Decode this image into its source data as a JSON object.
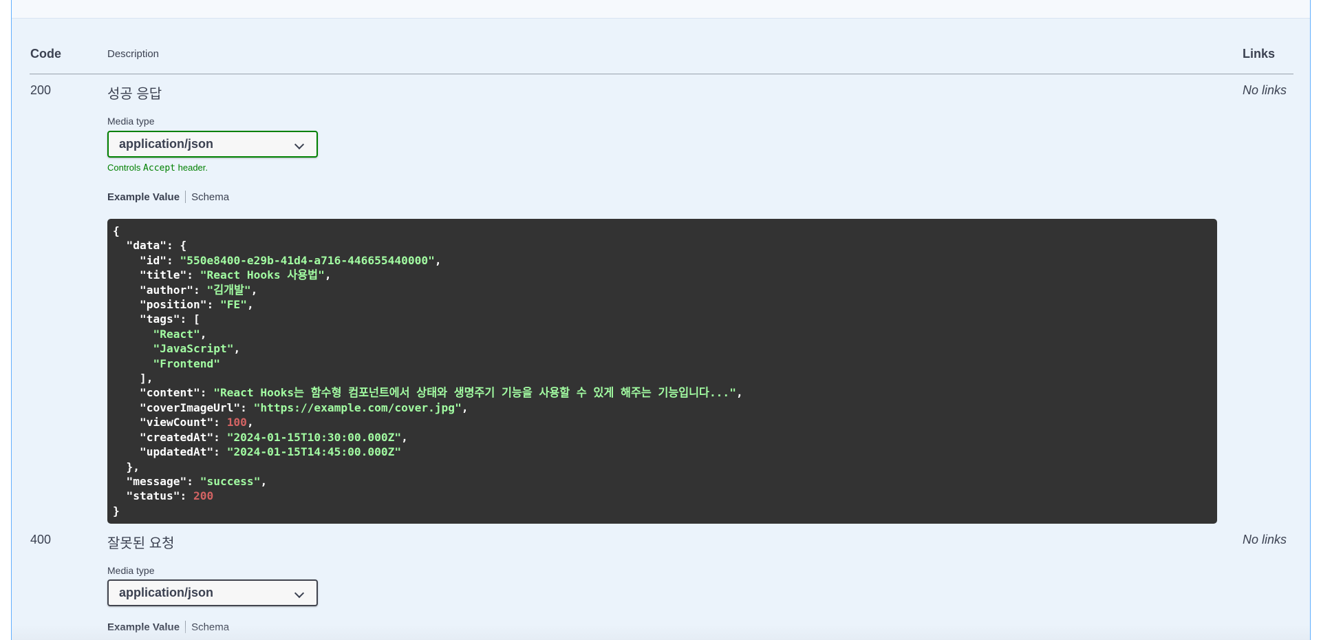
{
  "table": {
    "code_header": "Code",
    "description_header": "Description",
    "links_header": "Links"
  },
  "responses": [
    {
      "code": "200",
      "description": "성공 응답",
      "links": "No links",
      "media_type_label": "Media type",
      "media_type_value": "application/json",
      "controls_prefix": "Controls",
      "controls_code": "Accept",
      "controls_suffix": "header.",
      "tab_example": "Example Value",
      "tab_schema": "Schema"
    },
    {
      "code": "400",
      "description": "잘못된 요청",
      "links": "No links",
      "media_type_label": "Media type",
      "media_type_value": "application/json",
      "tab_example": "Example Value",
      "tab_schema": "Schema"
    }
  ],
  "example_200": {
    "id": "550e8400-e29b-41d4-a716-446655440000",
    "title": "React Hooks 사용법",
    "author": "김개발",
    "position": "FE",
    "tags": [
      "React",
      "JavaScript",
      "Frontend"
    ],
    "content": "React Hooks는 함수형 컴포넌트에서 상태와 생명주기 기능을 사용할 수 있게 해주는 기능입니다...",
    "coverImageUrl": "https://example.com/cover.jpg",
    "viewCount": "100",
    "createdAt": "2024-01-15T10:30:00.000Z",
    "updatedAt": "2024-01-15T14:45:00.000Z",
    "message": "success",
    "status": "200"
  },
  "colors": {
    "accent_blue": "#61affe",
    "section_bg": "#ebf3fb",
    "code_bg": "#333333",
    "string_green": "#a2fca2",
    "number_red": "#d36363",
    "active_select_border": "#008000"
  }
}
